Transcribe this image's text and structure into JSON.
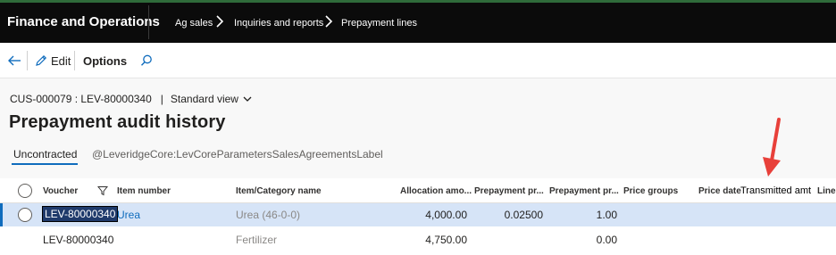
{
  "topbar": {
    "app_title": "Finance and Operations",
    "breadcrumbs": [
      "Ag sales",
      "Inquiries and reports",
      "Prepayment lines"
    ]
  },
  "actionbar": {
    "edit_label": "Edit",
    "options_label": "Options"
  },
  "page": {
    "record_caption": "CUS-000079 : LEV-80000340",
    "view_label": "Standard view",
    "title": "Prepayment audit history"
  },
  "tabs": [
    {
      "label": "Uncontracted",
      "active": true
    },
    {
      "label": "@LeveridgeCore:LevCoreParametersSalesAgreementsLabel",
      "active": false
    }
  ],
  "grid": {
    "columns": [
      "Voucher",
      "Item number",
      "Item/Category name",
      "Allocation amo...",
      "Prepayment pr...",
      "Prepayment pr...",
      "Price groups",
      "Price date",
      "Transmitted amt",
      "Line"
    ],
    "rows": [
      {
        "voucher": "LEV-80000340",
        "item_number": "Urea",
        "item_name": "Urea (46-0-0)",
        "allocation": "4,000.00",
        "prepay_pr1": "0.02500",
        "prepay_pr2": "1.00",
        "price_groups": "",
        "price_date": "",
        "transmitted_amt": "",
        "line": ""
      },
      {
        "voucher": "LEV-80000340",
        "item_number": "",
        "item_name": "Fertilizer",
        "allocation": "4,750.00",
        "prepay_pr1": "",
        "prepay_pr2": "0.00",
        "price_groups": "",
        "price_date": "",
        "transmitted_amt": "",
        "line": ""
      }
    ]
  },
  "colors": {
    "accent": "#0f6cbd",
    "annotation_arrow": "#e8403a",
    "topbar_bg": "#0b0b0b",
    "selected_row": "#d6e4f7"
  }
}
